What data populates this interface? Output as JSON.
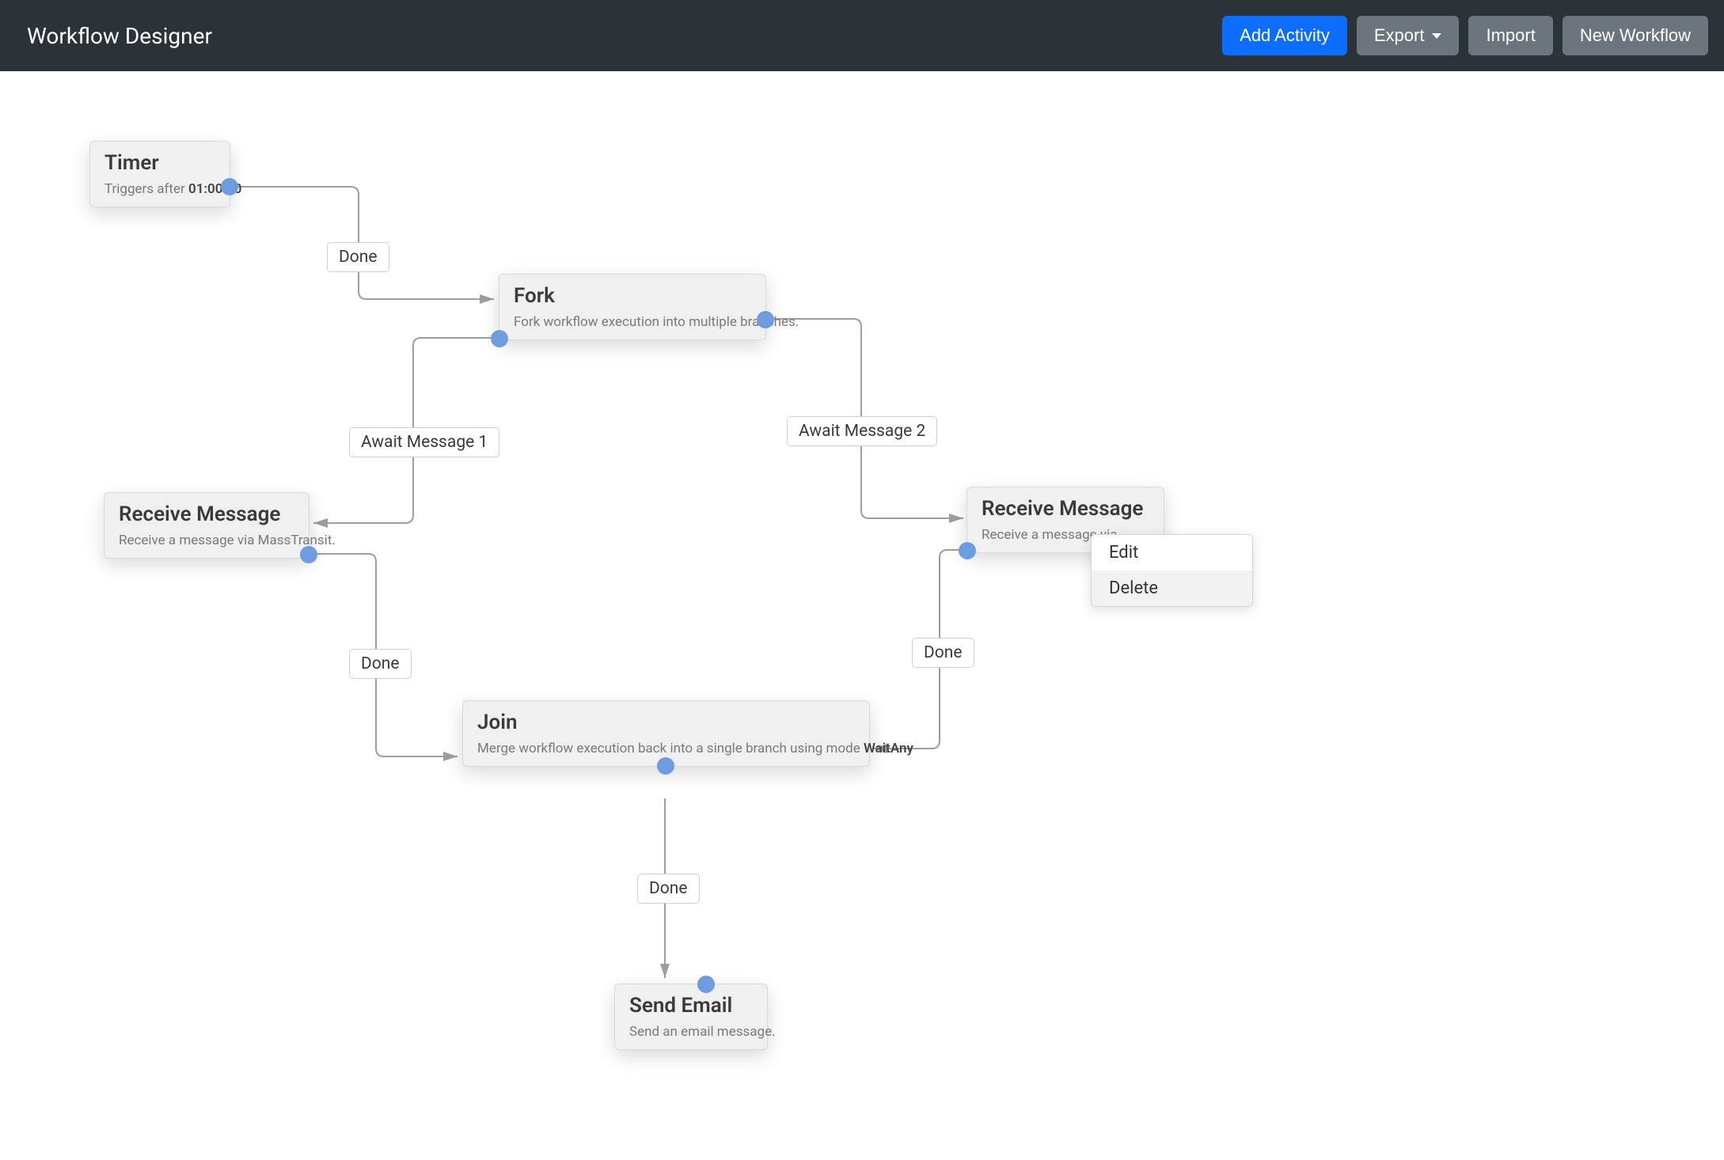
{
  "header": {
    "title": "Workflow Designer",
    "actions": {
      "add_activity": "Add Activity",
      "export": "Export",
      "import": "Import",
      "new_workflow": "New Workflow"
    }
  },
  "nodes": {
    "timer": {
      "title": "Timer",
      "desc_prefix": "Triggers after ",
      "desc_value": "01:00:00"
    },
    "fork": {
      "title": "Fork",
      "desc": "Fork workflow execution into multiple branches."
    },
    "recv1": {
      "title": "Receive Message",
      "desc": "Receive a message via MassTransit."
    },
    "recv2": {
      "title": "Receive Message",
      "desc": "Receive a message via "
    },
    "join": {
      "title": "Join",
      "desc_prefix": "Merge workflow execution back into a single branch using mode ",
      "desc_value": "WaitAny"
    },
    "email": {
      "title": "Send Email",
      "desc": "Send an email message."
    }
  },
  "edge_labels": {
    "timer_fork": "Done",
    "fork_recv1": "Await Message 1",
    "fork_recv2": "Await Message 2",
    "recv1_join": "Done",
    "recv2_join": "Done",
    "join_email": "Done"
  },
  "context_menu": {
    "edit": "Edit",
    "delete": "Delete"
  }
}
